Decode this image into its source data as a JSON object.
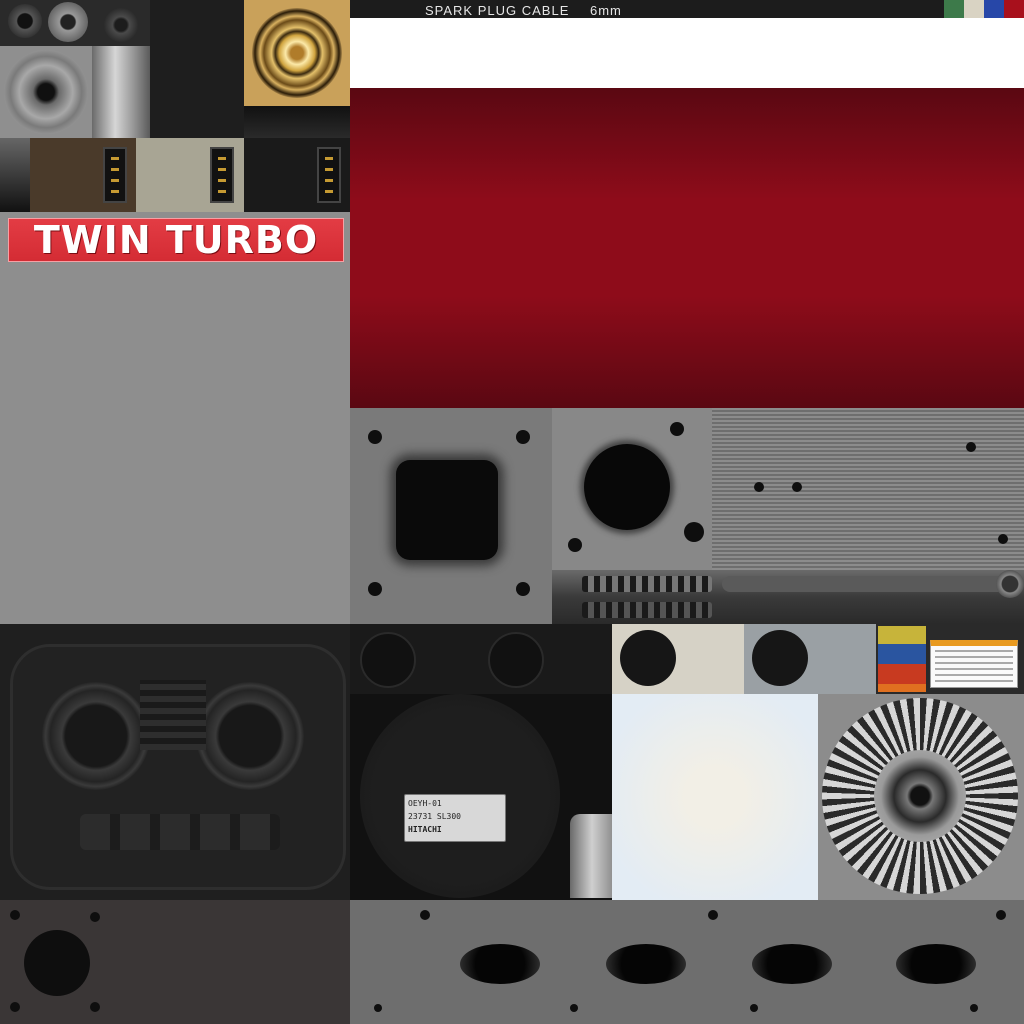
{
  "cable_strip": {
    "label": "SPARK PLUG CABLE",
    "size": "6mm",
    "swatches": [
      "#3d7a4a",
      "#d9d3c3",
      "#2747a8",
      "#a8101c"
    ]
  },
  "badge": {
    "text": "TWIN TURBO",
    "color": "#d62f37"
  },
  "motor_label": {
    "line1": "OEYH-01",
    "line2": "23731 SL300",
    "line3": "HITACHI"
  },
  "colors": {
    "red_panel": "#8e0c1a",
    "metal_grey": "#8a8a8a"
  }
}
